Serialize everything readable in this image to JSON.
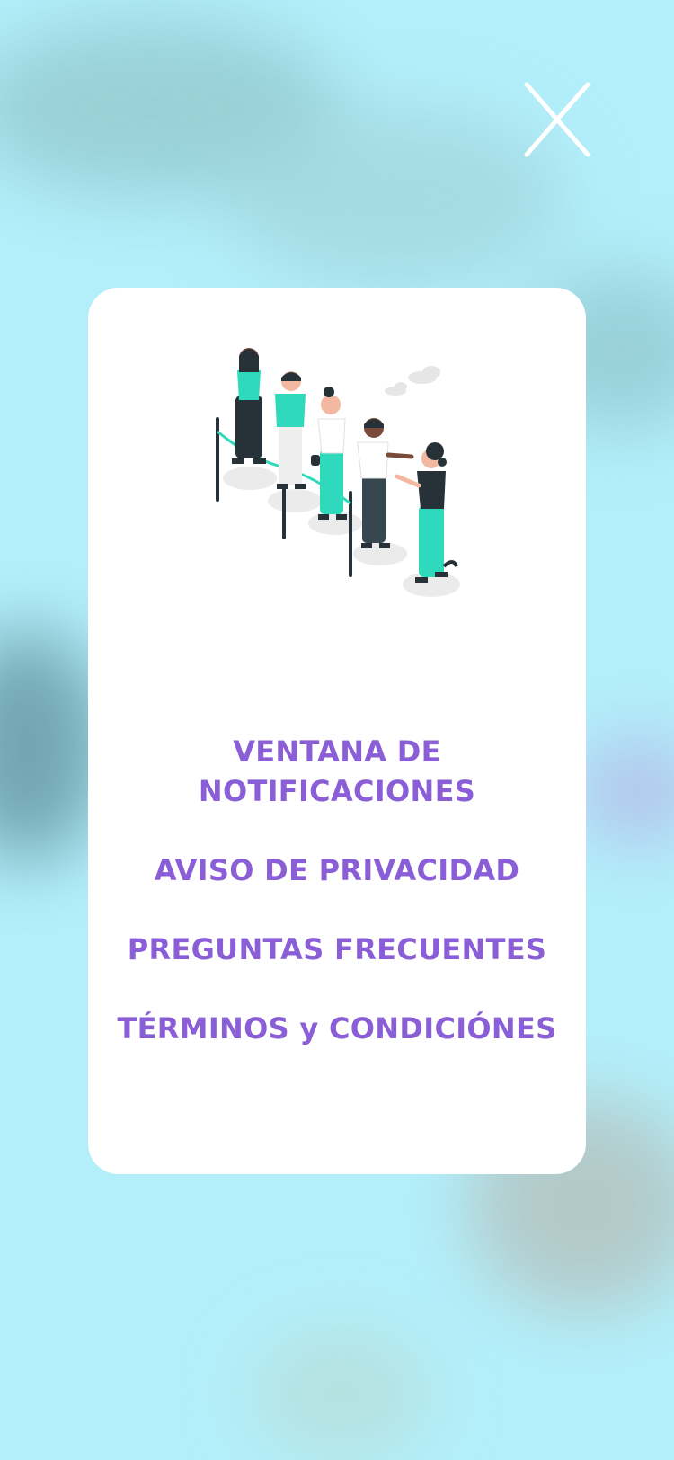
{
  "close_button": {
    "icon": "close-icon",
    "color": "#ffffff"
  },
  "illustration": {
    "description_icon": "people-queue-illustration",
    "accent_color": "#2fd9bc",
    "dark_color": "#263238"
  },
  "menu": {
    "color": "#8a5ed6",
    "items": [
      {
        "label": "VENTANA DE NOTIFICACIONES"
      },
      {
        "label": "AVISO DE PRIVACIDAD"
      },
      {
        "label": "PREGUNTAS FRECUENTES"
      },
      {
        "label": "TÉRMINOS y CONDICIÓNES"
      }
    ]
  }
}
